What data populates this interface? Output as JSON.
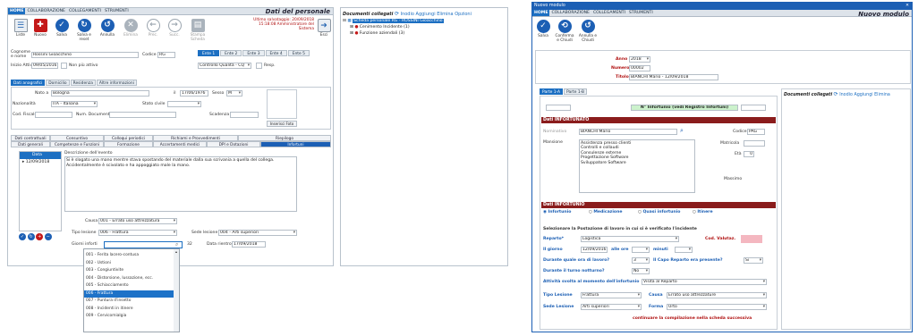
{
  "left": {
    "tabs": [
      "HOME",
      "COLLABORAZIONE",
      "COLLEGAMENTI",
      "STRUMENTI"
    ],
    "title": "Dati del personale",
    "toolbar": [
      {
        "label": "Liste",
        "icon": "list-icon"
      },
      {
        "label": "Nuovo",
        "icon": "new-doc-icon"
      },
      {
        "label": "Salva",
        "icon": "check-icon"
      },
      {
        "label": "Salva e reset",
        "icon": "save-reset-icon"
      },
      {
        "label": "Annulla",
        "icon": "undo-icon"
      },
      {
        "label": "Elimina",
        "icon": "delete-icon"
      },
      {
        "label": "Prec.",
        "icon": "arrow-left-icon"
      },
      {
        "label": "Succ.",
        "icon": "arrow-right-icon"
      },
      {
        "label": "Stampa Scheda",
        "icon": "printer-icon"
      },
      {
        "label": "Esci",
        "icon": "exit-icon"
      }
    ],
    "last_save": "Ultimo salvataggio: 20/09/2018 15:18:08 Amministratore del Sistema",
    "cognome_label": "Cognome e nome",
    "cognome_value": "Rossini Gioacchino",
    "codice_label": "Codice",
    "codice_value": "RG",
    "inizio_label": "Inizio Attività",
    "inizio_value": "09/05/2016",
    "non_piu_attivo": "Non più attivo",
    "ente_tabs": [
      "Ente 1",
      "Ente 2",
      "Ente 3",
      "Ente 4",
      "Ente 5"
    ],
    "ente_value": "Controllo Qualità - CQ",
    "resp": "Resp.",
    "sub_tabs": [
      "Dati anagrafici",
      "Domicilio",
      "Residenza",
      "Altre informazioni"
    ],
    "nato_label": "Nato a",
    "nato_value": "Bologna",
    "il_label": "il",
    "il_value": "17/06/1976",
    "sesso_label": "Sesso",
    "sesso_value": "M",
    "naz_label": "Nazionalità",
    "naz_value": "ITA - Italiana",
    "stato_label": "Stato civile",
    "cf_label": "Cod. Fiscale",
    "numdoc_label": "Num. Documento",
    "scad_label": "Scadenza",
    "foto_btn": "Inserisci Foto",
    "row1": [
      "Dati contrattuali",
      "Consuntivo",
      "Colloqui periodici",
      "Richiami e Provvedimenti",
      "Riepilogo"
    ],
    "row2": [
      "Dati generali",
      "Competenze e Funzioni",
      "Formazione",
      "Accertamenti medici",
      "DPI e Dotazioni",
      "Infortuni"
    ],
    "grid_header": "Data",
    "grid_date": "12/09/2018",
    "desc_label": "Descrizione dell'evento",
    "desc_text": "Si è slogato una mano mentre stava spostando del materiale dalla sua scrivania a quella del collega. Accidentalmente è scivolato e ha appoggiato male la mano.",
    "causa_label": "Causa",
    "causa_value": "001 - Errato uso attrezzatura",
    "tipo_label": "Tipo lesione",
    "tipo_value": "006 - Frattura",
    "sede_label": "Sede lesione",
    "sede_value": "004 - Arti superiori",
    "giorni_label": "Giorni inforti",
    "giorni_value": "32",
    "rientro_label": "Data rientro",
    "rientro_value": "17/09/2018",
    "dropdown": [
      "001 - Ferita lacero-contusa",
      "002 - Ustioni",
      "003 - Congiuntivite",
      "004 - Distorsione, lussazione, ecc.",
      "005 - Schiacciamento",
      "006 - Frattura",
      "007 - Puntura d'insetto",
      "008 - Incidenti in itinere",
      "009 - Cervicomialgia"
    ]
  },
  "middle": {
    "header": "Documenti collegati",
    "actions": [
      "Inodio",
      "Aggiungi",
      "Elimina",
      "Opzioni"
    ],
    "tree_root": "Scheda personale RG - ROSSINI Gioacchino",
    "tree_items": [
      "Cenimento Incidente (1)",
      "Funzione aziendali (3)"
    ]
  },
  "right": {
    "win_title": "Nuovo modulo",
    "tabs": [
      "HOME",
      "COLLABORAZIONE",
      "COLLEGAMENTI",
      "STRUMENTI"
    ],
    "title": "Nuovo modulo",
    "toolbar": [
      "Salva",
      "Conferma e Chiudi",
      "Annulla e Chiudi"
    ],
    "anno_label": "Anno",
    "anno_value": "2018",
    "numero_label": "Numero",
    "numero_value": "00002",
    "titolo_label": "Titolo",
    "titolo_value": "BIANCHI Mario - 12/09/2018",
    "part_tabs": [
      "Parte 1-A",
      "Parte 1-B"
    ],
    "n_infortunio": "N° Infortunio (vedi Registro Infortuni)",
    "sec_inf": "Dati INFORTUNATO",
    "nom_label": "Nominativo",
    "nom_value": "BIANCHI Mario",
    "codice_label": "Codice",
    "codice_value": "PAG",
    "mansione_label": "Mansione",
    "mansione_lines": [
      "Assistenza presso clienti",
      "Controlli e collaudi",
      "Consulenze esterne",
      "Progettazione Software",
      "Sviluppatore Software"
    ],
    "matricola_label": "Matricola",
    "eta_label": "Età",
    "eta_value": "0",
    "massimo": "Massimo",
    "sec_dati": "Dati INFORTUNIO",
    "radios": [
      "Infortunio",
      "Medicazione",
      "Quasi infortunio",
      "Itinere"
    ],
    "postazione": "Selezionare la Postazione di lavoro in cui si è verificato l'incidente",
    "reparto_label": "Reparto*",
    "reparto_value": "Logistica",
    "valutaz_label": "Cod. Valutaz.",
    "giorno_label": "Il giorno",
    "giorno_value": "12/09/2016",
    "alle_ore": "alle ore",
    "minuti": "minuti",
    "ora_q": "Durante quale ora di lavoro?",
    "ora_value": "3",
    "capo_q": "Il Capo Reparto era presente?",
    "capo_value": "Si",
    "notturno_q": "Durante il turno notturno?",
    "notturno_value": "No",
    "attivita_q": "Attività svolta al momento dell'infortunio",
    "attivita_value": "Visita al Reparto",
    "tipo_label": "Tipo Lesione",
    "tipo_value": "Frattura",
    "causa_label": "Causa",
    "causa_value": "Errato uso attrezzature",
    "sede_label": "Sede Lesione",
    "sede_value": "Arti superiori",
    "forma_label": "Forma",
    "forma_value": "Urto",
    "continue": "continuare la compilazione nella scheda successiva",
    "doc_header": "Documenti collegati",
    "doc_actions": [
      "Inodio",
      "Aggiungi",
      "Elimina"
    ]
  },
  "colors": {
    "accent": "#1c6fc2",
    "section": "#8a1c1c",
    "pink": "#f4b7c0",
    "green": "#ccf2cc"
  }
}
